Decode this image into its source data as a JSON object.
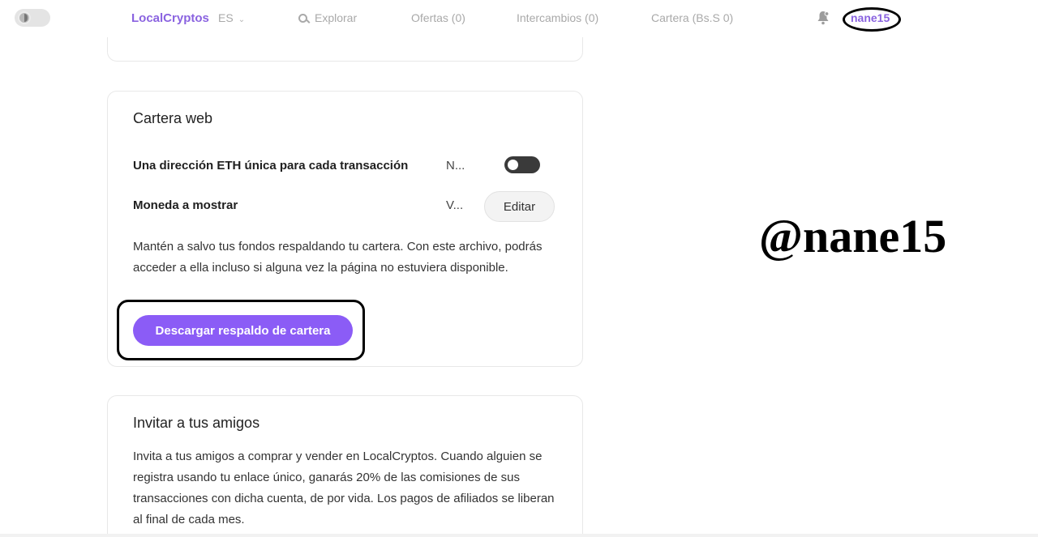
{
  "nav": {
    "brand": "LocalCryptos",
    "language": "ES",
    "explore": "Explorar",
    "offers": "Ofertas (0)",
    "trades": "Intercambios (0)",
    "wallet": "Cartera (Bs.S 0)",
    "username": "nane15"
  },
  "wallet_card": {
    "title": "Cartera web",
    "unique_address_label": "Una dirección ETH única para cada transacción",
    "unique_address_value": "N...",
    "unique_address_enabled": false,
    "display_currency_label": "Moneda a mostrar",
    "display_currency_value": "V...",
    "edit_label": "Editar",
    "backup_text": "Mantén a salvo tus fondos respaldando tu cartera. Con este archivo, podrás acceder a ella incluso si alguna vez la página no estuviera disponible.",
    "backup_button": "Descargar respaldo de cartera"
  },
  "invite_card": {
    "title": "Invitar a tus amigos",
    "text": "Invita a tus amigos a comprar y vender en LocalCryptos. Cuando alguien se registra usando tu enlace único, ganarás 20% de las comisiones de sus transacciones con dicha cuenta, de por vida. Los pagos de afiliados se liberan al final de cada mes."
  },
  "watermark": "@nane15",
  "colors": {
    "accent": "#8b5cf6",
    "brand": "#8a63e0"
  }
}
